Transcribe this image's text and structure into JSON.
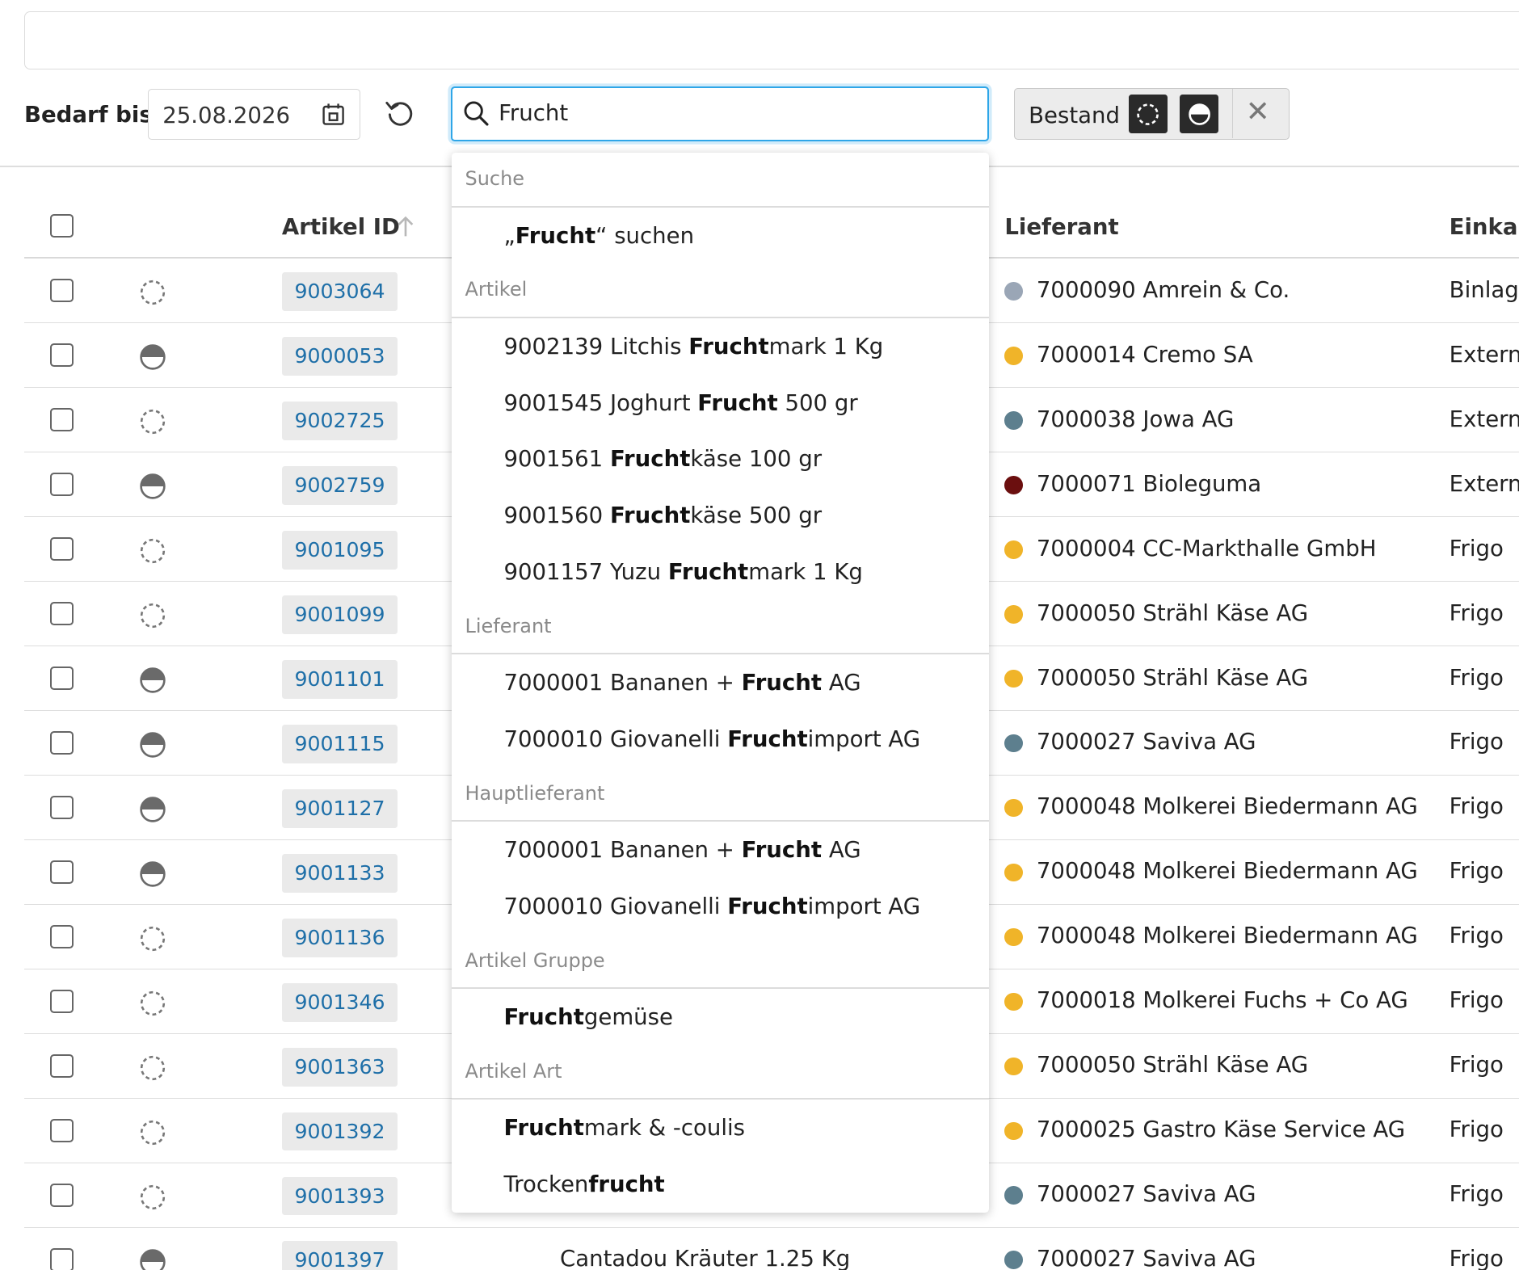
{
  "filter": {
    "label": "Bedarf bis",
    "date": "25.08.2026"
  },
  "search": {
    "value": "Frucht"
  },
  "bestand": {
    "label": "Bestand",
    "close": "✕"
  },
  "table": {
    "headers": {
      "artikel_id": "Artikel ID",
      "lieferant": "Lieferant",
      "einkauf": "Einkau"
    },
    "rows": [
      {
        "id": "9003064",
        "name": "",
        "supplier": "7000090 Amrein & Co.",
        "einkauf": "Binlage",
        "status": "dashed",
        "dot": "#9aa6b6"
      },
      {
        "id": "9000053",
        "name": "",
        "supplier": "7000014 Cremo SA",
        "einkauf": "Extern",
        "status": "half",
        "dot": "#f0b429"
      },
      {
        "id": "9002725",
        "name": "",
        "supplier": "7000038 Jowa AG",
        "einkauf": "Extern",
        "status": "dashed",
        "dot": "#5d7f8e"
      },
      {
        "id": "9002759",
        "name": "",
        "supplier": "7000071 Bioleguma",
        "einkauf": "Extern",
        "status": "half",
        "dot": "#6b0f0f"
      },
      {
        "id": "9001095",
        "name": "",
        "supplier": "7000004 CC-Markthalle GmbH",
        "einkauf": "Frigo",
        "status": "dashed",
        "dot": "#f0b429"
      },
      {
        "id": "9001099",
        "name": "",
        "supplier": "7000050 Strähl Käse AG",
        "einkauf": "Frigo",
        "status": "dashed",
        "dot": "#f0b429"
      },
      {
        "id": "9001101",
        "name": "",
        "supplier": "7000050 Strähl Käse AG",
        "einkauf": "Frigo",
        "status": "half",
        "dot": "#f0b429"
      },
      {
        "id": "9001115",
        "name": "",
        "supplier": "7000027 Saviva AG",
        "einkauf": "Frigo",
        "status": "half",
        "dot": "#5d7f8e"
      },
      {
        "id": "9001127",
        "name": "",
        "supplier": "7000048 Molkerei Biedermann AG",
        "einkauf": "Frigo",
        "status": "half",
        "dot": "#f0b429"
      },
      {
        "id": "9001133",
        "name": "",
        "supplier": "7000048 Molkerei Biedermann AG",
        "einkauf": "Frigo",
        "status": "half",
        "dot": "#f0b429"
      },
      {
        "id": "9001136",
        "name": "",
        "supplier": "7000048 Molkerei Biedermann AG",
        "einkauf": "Frigo",
        "status": "dashed",
        "dot": "#f0b429"
      },
      {
        "id": "9001346",
        "name": "",
        "supplier": "7000018 Molkerei Fuchs + Co AG",
        "einkauf": "Frigo",
        "status": "dashed",
        "dot": "#f0b429"
      },
      {
        "id": "9001363",
        "name": "",
        "supplier": "7000050 Strähl Käse AG",
        "einkauf": "Frigo",
        "status": "dashed",
        "dot": "#f0b429"
      },
      {
        "id": "9001392",
        "name": "",
        "supplier": "7000025 Gastro Käse Service AG",
        "einkauf": "Frigo",
        "status": "dashed",
        "dot": "#f0b429"
      },
      {
        "id": "9001393",
        "name": "",
        "supplier": "7000027 Saviva AG",
        "einkauf": "Frigo",
        "status": "dashed",
        "dot": "#5d7f8e"
      },
      {
        "id": "9001397",
        "name": "Cantadou Kräuter 1.25 Kg",
        "supplier": "7000027 Saviva AG",
        "einkauf": "Frigo",
        "status": "half",
        "dot": "#5d7f8e"
      }
    ]
  },
  "dropdown": {
    "sections": [
      {
        "title": "Suche",
        "items": [
          [
            [
              "„",
              false
            ],
            [
              "Frucht",
              true
            ],
            [
              "“ suchen",
              false
            ]
          ]
        ]
      },
      {
        "title": "Artikel",
        "items": [
          [
            [
              "9002139 Litchis ",
              false
            ],
            [
              "Frucht",
              true
            ],
            [
              "mark 1 Kg",
              false
            ]
          ],
          [
            [
              "9001545 Joghurt ",
              false
            ],
            [
              "Frucht",
              true
            ],
            [
              " 500 gr",
              false
            ]
          ],
          [
            [
              "9001561 ",
              false
            ],
            [
              "Frucht",
              true
            ],
            [
              "käse 100 gr",
              false
            ]
          ],
          [
            [
              "9001560 ",
              false
            ],
            [
              "Frucht",
              true
            ],
            [
              "käse 500 gr",
              false
            ]
          ],
          [
            [
              "9001157 Yuzu ",
              false
            ],
            [
              "Frucht",
              true
            ],
            [
              "mark 1 Kg",
              false
            ]
          ]
        ]
      },
      {
        "title": "Lieferant",
        "items": [
          [
            [
              "7000001 Bananen + ",
              false
            ],
            [
              "Frucht",
              true
            ],
            [
              " AG",
              false
            ]
          ],
          [
            [
              "7000010 Giovanelli ",
              false
            ],
            [
              "Frucht",
              true
            ],
            [
              "import AG",
              false
            ]
          ]
        ]
      },
      {
        "title": "Hauptlieferant",
        "items": [
          [
            [
              "7000001 Bananen + ",
              false
            ],
            [
              "Frucht",
              true
            ],
            [
              " AG",
              false
            ]
          ],
          [
            [
              "7000010 Giovanelli ",
              false
            ],
            [
              "Frucht",
              true
            ],
            [
              "import AG",
              false
            ]
          ]
        ]
      },
      {
        "title": "Artikel Gruppe",
        "items": [
          [
            [
              "Frucht",
              true
            ],
            [
              "gemüse",
              false
            ]
          ]
        ]
      },
      {
        "title": "Artikel Art",
        "items": [
          [
            [
              "Frucht",
              true
            ],
            [
              "mark & -coulis",
              false
            ]
          ],
          [
            [
              "Trocken",
              false
            ],
            [
              "frucht",
              true
            ]
          ]
        ]
      }
    ]
  }
}
